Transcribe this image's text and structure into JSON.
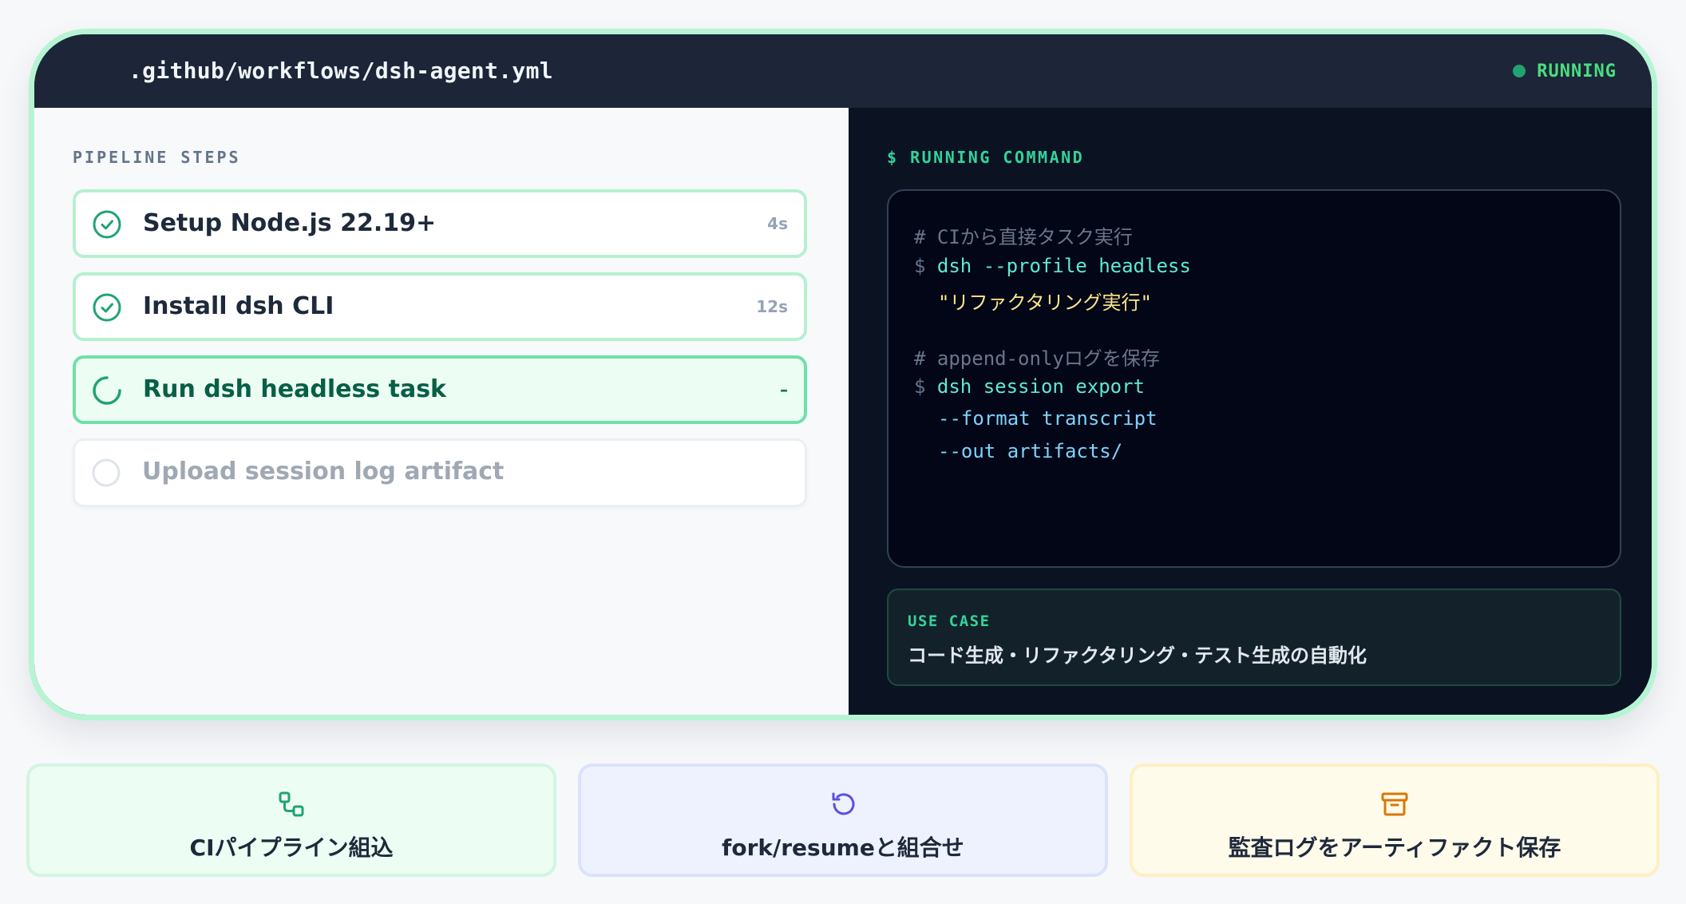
{
  "window": {
    "file_path": ".github/workflows/dsh-agent.yml",
    "status": "RUNNING"
  },
  "colors": {
    "accent": "#21a371",
    "border": "#b5f5d3",
    "terminal_bg": "#020617"
  },
  "pipeline": {
    "section_label": "PIPELINE STEPS",
    "steps": [
      {
        "label": "Setup Node.js 22.19+",
        "time": "4s",
        "state": "done",
        "icon": "check-circle-icon"
      },
      {
        "label": "Install dsh CLI",
        "time": "12s",
        "state": "done",
        "icon": "check-circle-icon"
      },
      {
        "label": "Run dsh headless task",
        "time": "–",
        "state": "running",
        "icon": "spinner-icon"
      },
      {
        "label": "Upload session log artifact",
        "time": "",
        "state": "pending",
        "icon": "empty-circle-icon"
      }
    ]
  },
  "command": {
    "section_label": "$ RUNNING COMMAND",
    "lines": {
      "l1": "# CIから直接タスク実行",
      "l2_prompt": "$",
      "l2_cmd": "dsh --profile headless",
      "l3": "\"リファクタリング実行\"",
      "l4": "# append-onlyログを保存",
      "l5_prompt": "$",
      "l5_cmd": "dsh session export",
      "l6": "--format transcript",
      "l7": "--out artifacts/"
    }
  },
  "usecase": {
    "label": "USE CASE",
    "text": "コード生成・リファクタリング・テスト生成の自動化"
  },
  "features": [
    {
      "label": "CIパイプライン組込",
      "icon": "workflow-icon"
    },
    {
      "label": "fork/resumeと組合せ",
      "icon": "rotate-ccw-icon"
    },
    {
      "label": "監査ログをアーティファクト保存",
      "icon": "archive-icon"
    }
  ]
}
